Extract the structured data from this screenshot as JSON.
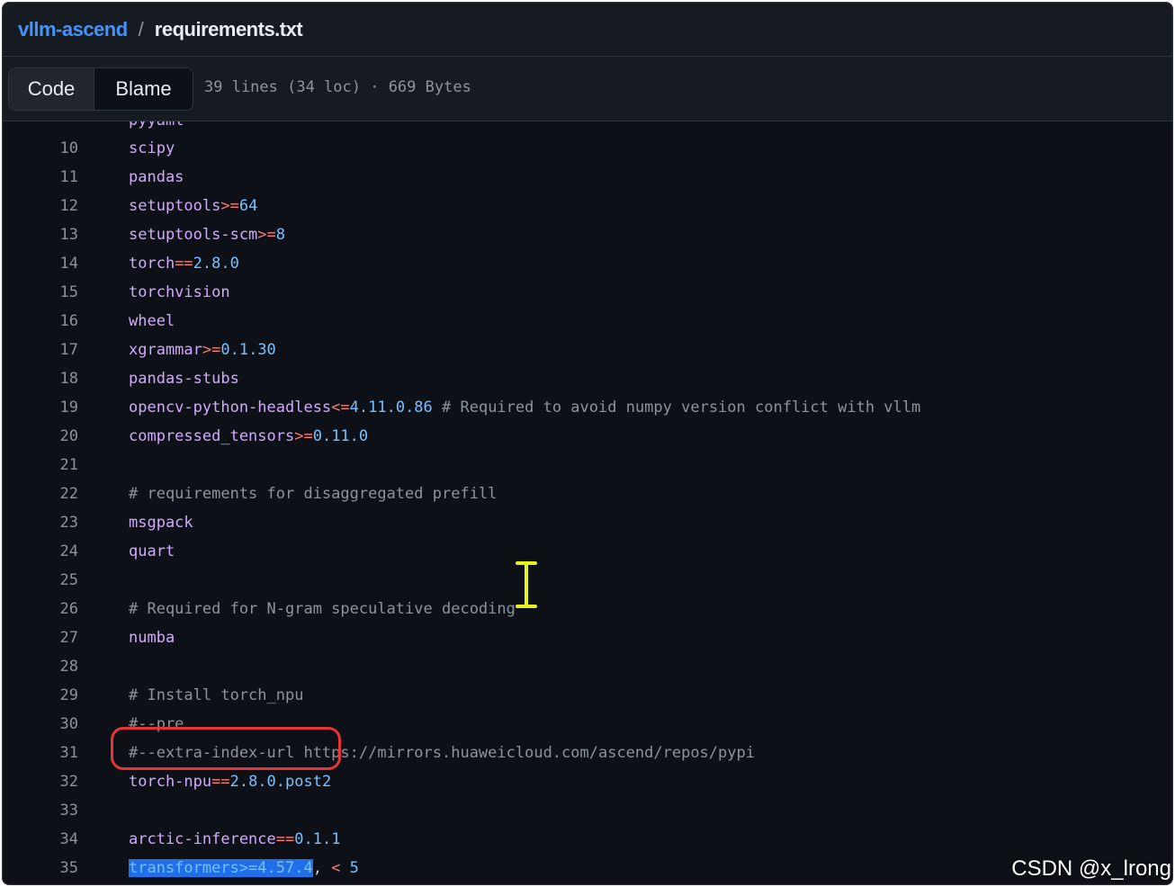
{
  "breadcrumb": {
    "repo": "vllm-ascend",
    "separator": "/",
    "file": "requirements.txt"
  },
  "toolbar": {
    "code_label": "Code",
    "blame_label": "Blame",
    "file_info": "39 lines (34 loc) · 669 Bytes"
  },
  "partial_line": {
    "text": "pyyaml"
  },
  "lines": [
    {
      "n": "10",
      "pkg": "scipy"
    },
    {
      "n": "11",
      "pkg": "pandas"
    },
    {
      "n": "12",
      "pkg": "setuptools",
      "op": ">=",
      "ver": "64"
    },
    {
      "n": "13",
      "pkg": "setuptools-scm",
      "op": ">=",
      "ver": "8"
    },
    {
      "n": "14",
      "pkg": "torch",
      "op": "==",
      "ver": "2.8.0"
    },
    {
      "n": "15",
      "pkg": "torchvision"
    },
    {
      "n": "16",
      "pkg": "wheel"
    },
    {
      "n": "17",
      "pkg": "xgrammar",
      "op": ">=",
      "ver": "0.1.30"
    },
    {
      "n": "18",
      "pkg": "pandas-stubs"
    },
    {
      "n": "19",
      "pkg": "opencv-python-headless",
      "op": "<=",
      "ver": "4.11.0.86",
      "comment": " # Required to avoid numpy version conflict with vllm"
    },
    {
      "n": "20",
      "pkg": "compressed_tensors",
      "op": ">=",
      "ver": "0.11.0"
    },
    {
      "n": "21"
    },
    {
      "n": "22",
      "comment": "# requirements for disaggregated prefill"
    },
    {
      "n": "23",
      "pkg": "msgpack"
    },
    {
      "n": "24",
      "pkg": "quart"
    },
    {
      "n": "25"
    },
    {
      "n": "26",
      "comment": "# Required for N-gram speculative decoding"
    },
    {
      "n": "27",
      "pkg": "numba"
    },
    {
      "n": "28"
    },
    {
      "n": "29",
      "comment": "# Install torch_npu"
    },
    {
      "n": "30",
      "comment": "#--pre"
    },
    {
      "n": "31",
      "comment": "#--extra-index-url https://mirrors.huaweicloud.com/ascend/repos/pypi"
    },
    {
      "n": "32",
      "pkg": "torch-npu",
      "op": "==",
      "ver": "2.8.0.post2"
    },
    {
      "n": "33"
    },
    {
      "n": "34",
      "pkg": "arctic-inference",
      "op": "==",
      "ver": "0.1.1"
    },
    {
      "n": "35",
      "selected": "transformers>=4.57.4",
      "rest": ",",
      "op2": " <",
      "ver2": " 5"
    }
  ],
  "watermark": "CSDN @x_lrong",
  "colors": {
    "background": "#0d1117",
    "package": "#d2a8ff",
    "operator": "#ff7b72",
    "version": "#79c0ff",
    "comment": "#8b949e",
    "link": "#4493f8",
    "selection": "#1f6feb",
    "highlight_ring": "#e5353a"
  }
}
